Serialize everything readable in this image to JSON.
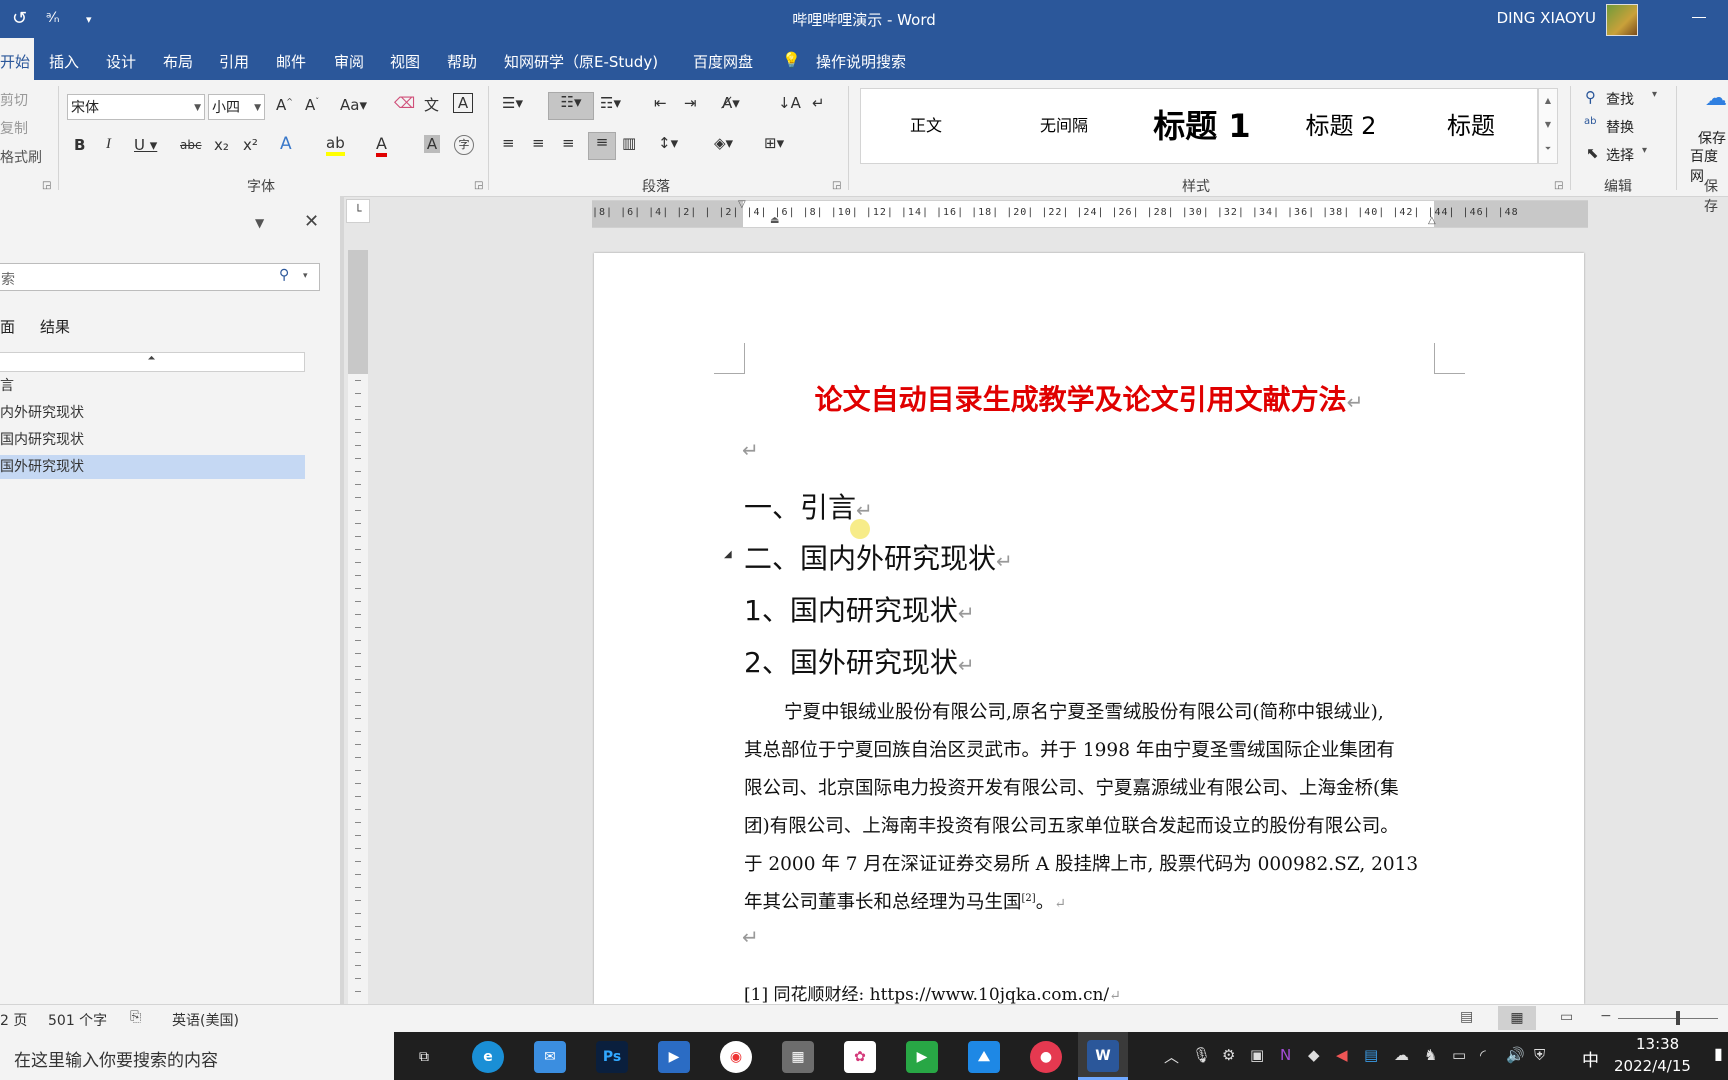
{
  "title_bar": {
    "doc_title": "哔哩哔哩演示 - Word",
    "user_name": "DING XIAOYU"
  },
  "menu_tabs": [
    "开始",
    "插入",
    "设计",
    "布局",
    "引用",
    "邮件",
    "审阅",
    "视图",
    "帮助",
    "知网研学（原E-Study)",
    "百度网盘",
    "操作说明搜索"
  ],
  "clipboard": {
    "cut": "剪切",
    "copy": "复制",
    "format_painter": "格式刷"
  },
  "font_group": {
    "font_name": "宋体",
    "font_size": "小四",
    "label": "字体"
  },
  "paragraph_group": {
    "label": "段落"
  },
  "styles": {
    "items": [
      "正文",
      "无间隔",
      "标题 1",
      "标题 2",
      "标题"
    ],
    "label": "样式"
  },
  "editing": {
    "find": "查找",
    "replace": "替换",
    "select": "选择",
    "label": "编辑"
  },
  "save_group": {
    "line1": "保存",
    "line2": "百度网",
    "label": "保存"
  },
  "nav_pane": {
    "search_placeholder": "索",
    "tabs": [
      "面",
      "结果"
    ],
    "items": [
      "言",
      "内外研究现状",
      "国内研究现状",
      "国外研究现状"
    ],
    "selected_index": 3
  },
  "document": {
    "title": "论文自动目录生成教学及论文引用文献方法",
    "headings": [
      "一、引言",
      "二、国内外研究现状",
      "1、国内研究现状",
      "2、国外研究现状"
    ],
    "body_lines": [
      "宁夏中银绒业股份有限公司,原名宁夏圣雪绒股份有限公司(简称中银绒业),",
      "其总部位于宁夏回族自治区灵武市。并于 1998 年由宁夏圣雪绒国际企业集团有",
      "限公司、北京国际电力投资开发有限公司、宁夏嘉源绒业有限公司、上海金桥(集",
      "团)有限公司、上海南丰投资有限公司五家单位联合发起而设立的股份有限公司。",
      "于 2000 年 7 月在深证证券交易所 A 股挂牌上市, 股票代码为 000982.SZ, 2013",
      "年其公司董事长和总经理为马生国"
    ],
    "footnote_ref": "[2]",
    "footnote": "[1] 同花顺财经: https://www.10jqka.com.cn/",
    "ruler_ticks": "|8| |6| |4| |2| | |2| |4| |6| |8| |10| |12| |14| |16| |18| |20| |22| |24| |26| |28| |30| |32| |34| |36| |38| |40| |42| |44| |46| |48"
  },
  "status_bar": {
    "page": "2 页",
    "word_count": "501 个字",
    "language": "英语(美国)"
  },
  "taskbar": {
    "search_placeholder": "在这里输入你要搜索的内容",
    "time": "13:38",
    "date": "2022/4/15",
    "ime": "中"
  }
}
